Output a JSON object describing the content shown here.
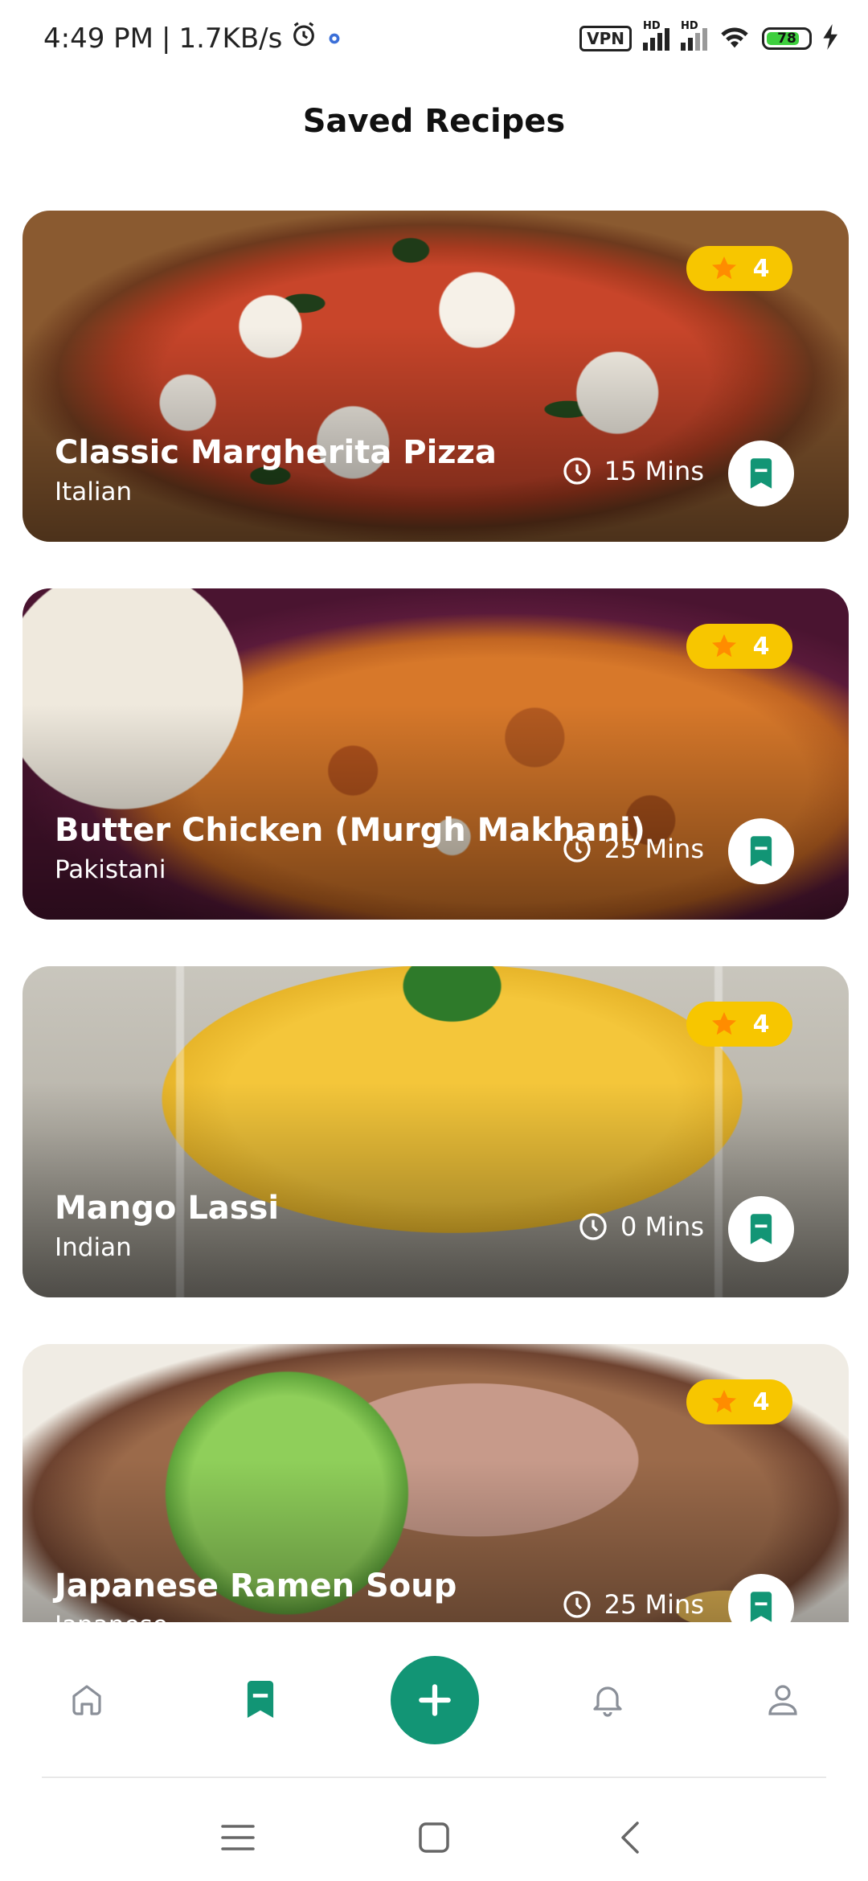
{
  "status_bar": {
    "time": "4:49 PM",
    "speed": "1.7KB/s",
    "vpn_label": "VPN",
    "hd_label": "HD",
    "battery_level": "78"
  },
  "header": {
    "title": "Saved Recipes"
  },
  "recipes": [
    {
      "title": "Classic Margherita Pizza",
      "cuisine": "Italian",
      "rating": "4",
      "time": "15 Mins"
    },
    {
      "title": "Butter Chicken (Murgh Makhani)",
      "cuisine": "Pakistani",
      "rating": "4",
      "time": "25 Mins"
    },
    {
      "title": "Mango Lassi",
      "cuisine": "Indian",
      "rating": "4",
      "time": "0 Mins"
    },
    {
      "title": "Japanese Ramen Soup",
      "cuisine": "Japanese",
      "rating": "4",
      "time": "25 Mins"
    }
  ],
  "bottom_nav": {
    "items": [
      "home-icon",
      "bookmark-icon",
      "add-icon",
      "bell-icon",
      "profile-icon"
    ],
    "active": "bookmark-icon"
  },
  "colors": {
    "accent": "#129575",
    "rating_badge": "#f7c600",
    "star": "#ff8c00"
  }
}
